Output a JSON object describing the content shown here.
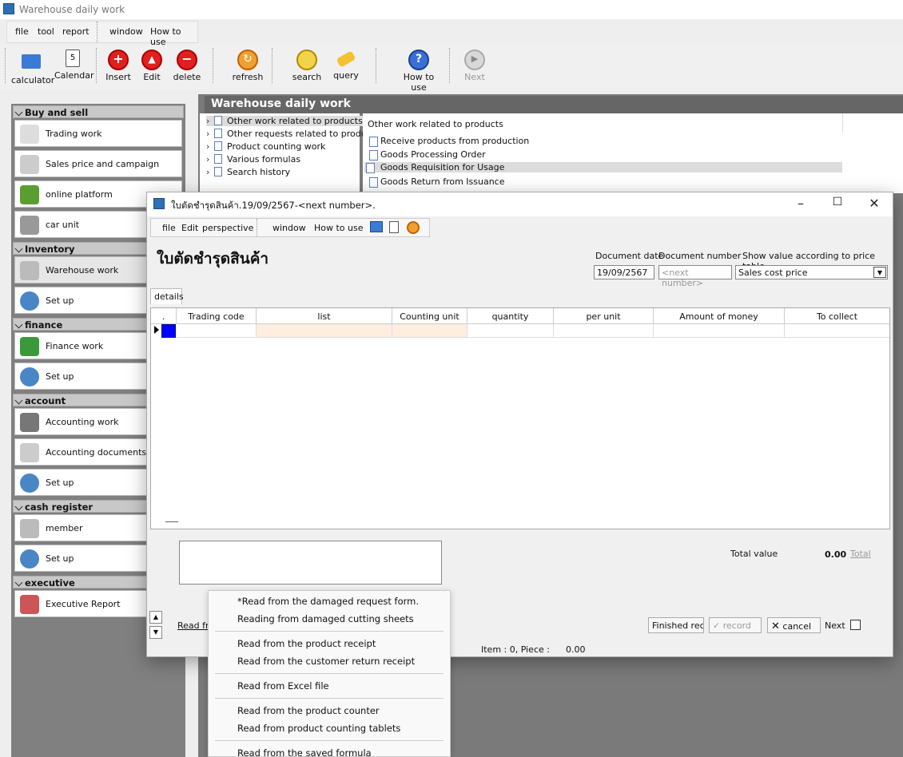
{
  "app": {
    "title": "Warehouse daily work"
  },
  "menubar": {
    "items": [
      "file",
      "tool",
      "report",
      "window",
      "How to use"
    ]
  },
  "toolbar": {
    "calculator": "calculator",
    "calendar": "Calendar",
    "insert": "Insert",
    "edit": "Edit",
    "delete": "delete",
    "refresh": "refresh",
    "search": "search",
    "query": "query",
    "howto": "How to use",
    "next": "Next"
  },
  "sidebar": {
    "groups": {
      "buysell": "Buy and sell",
      "inventory": "Inventory",
      "finance": "finance",
      "account": "account",
      "cash": "cash register",
      "executive": "executive"
    },
    "items": {
      "trading": "Trading work",
      "sales_price": "Sales price and campaign",
      "online": "online platform",
      "car": "car unit",
      "warehouse": "Warehouse work",
      "setup": "Set up",
      "finance_work": "Finance work",
      "accounting_work": "Accounting work",
      "accounting_docs": "Accounting documents",
      "member": "member",
      "exec_report": "Executive Report"
    }
  },
  "main": {
    "header": "Warehouse daily work",
    "tree": [
      "Other work related to products",
      "Other requests related to produ",
      "Product counting work",
      "Various formulas",
      "Search history"
    ],
    "list_title": "Other work related to products",
    "list": [
      "Receive products from production",
      "Goods Processing Order",
      "Goods Requisition for Usage",
      "Goods Return from Issuance"
    ]
  },
  "dialog": {
    "title": "ใบตัดชำรุดสินค้า.19/09/2567-<next number>.",
    "menu": [
      "file",
      "Edit",
      "perspective",
      "window",
      "How to use"
    ],
    "heading": "ใบตัดชำรุดสินค้า",
    "doc_date_label": "Document date",
    "doc_date": "19/09/2567",
    "doc_number_label": "Document number",
    "doc_number_placeholder": "<next number>",
    "price_label": "Show value according to price table",
    "price_value": "Sales cost price",
    "tab": "details",
    "columns": [
      ".",
      "Trading code",
      "list",
      "Counting unit",
      "quantity",
      "per unit",
      "Amount of money",
      "To collect"
    ],
    "total_label": "Total value",
    "total_value": "0.00",
    "total_link": "Total",
    "read_link": "Read fr",
    "finished": "Finished recor",
    "record": "record",
    "cancel": "cancel",
    "next": "Next",
    "status": "Item : 0, Piece :",
    "status_value": "0.00"
  },
  "popup": {
    "items": [
      "*Read from the damaged request form.",
      "Reading from damaged cutting sheets",
      "Read from the product receipt",
      "Read from the customer return receipt",
      "Read from Excel file",
      "Read from the product counter",
      "Read from product counting tablets",
      "Read from the saved formula"
    ]
  },
  "colors": {
    "accent": "#0000ff",
    "header_bg": "#666666",
    "selected": "#dcdcdc",
    "row_highlight": "#fdeee0"
  }
}
